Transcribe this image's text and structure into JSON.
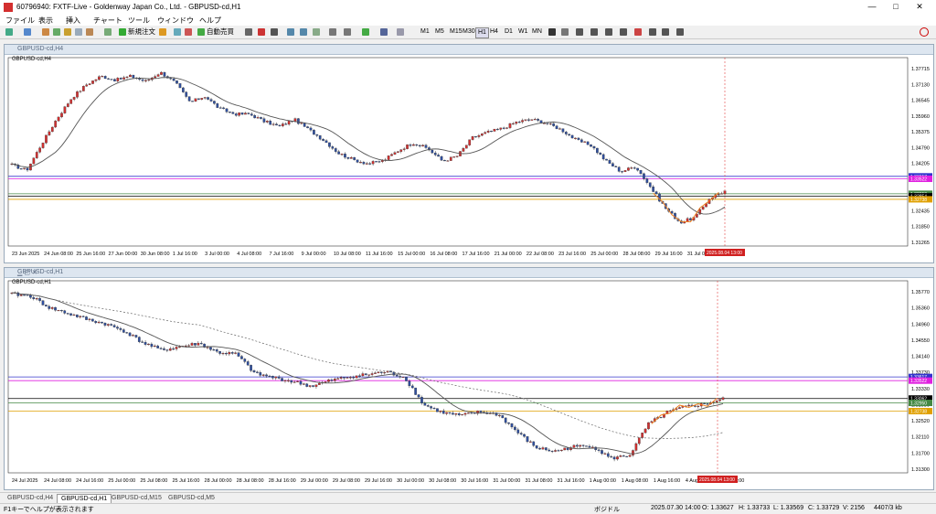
{
  "window": {
    "title": "60796940: FXTF-Live - Goldenway Japan Co., Ltd. - GBPUSD-cd,H1",
    "minimize": "—",
    "maximize": "□",
    "close": "✕"
  },
  "menu": [
    "ファイル",
    "表示",
    "挿入",
    "チャート",
    "ツール",
    "ウィンドウ",
    "ヘルプ"
  ],
  "toolbar": {
    "new_order": "新規注文",
    "auto_trade": "自動売買",
    "timeframes": [
      "M1",
      "M5",
      "M15",
      "M30",
      "H1",
      "H4",
      "D1",
      "W1",
      "MN"
    ]
  },
  "chart_h4": {
    "window_title": "GBPUSD-cd,H4",
    "symbol": "GBPUSD-cd,H4",
    "y_labels": [
      "1.37715",
      "1.37130",
      "1.36545",
      "1.35960",
      "1.35375",
      "1.34790",
      "1.34205",
      "1.33620",
      "1.33035",
      "1.32435",
      "1.31850",
      "1.31265"
    ],
    "price_tags": [
      {
        "text": "1.33617",
        "color": "#3333cc",
        "y": 1.33617
      },
      {
        "text": "1.33522",
        "color": "#e020e0",
        "y": 1.33522
      },
      {
        "text": "1.32950",
        "color": "#448844",
        "y": 1.3295
      },
      {
        "text": "1.32854",
        "color": "#000000",
        "y": 1.32854
      },
      {
        "text": "1.32738",
        "color": "#e0a000",
        "y": 1.32738
      }
    ],
    "x_labels": [
      "23 Jun 2025",
      "24 Jun 08:00",
      "25 Jun 16:00",
      "27 Jun 00:00",
      "30 Jun 08:00",
      "1 Jul 16:00",
      "3 Jul 00:00",
      "4 Jul 08:00",
      "7 Jul 16:00",
      "9 Jul 00:00",
      "10 Jul 08:00",
      "11 Jul 16:00",
      "15 Jul 00:00",
      "16 Jul 08:00",
      "17 Jul 16:00",
      "21 Jul 00:00",
      "22 Jul 08:00",
      "23 Jul 16:00",
      "25 Jul 00:00",
      "28 Jul 08:00",
      "29 Jul 16:00",
      "31 Jul 00:00",
      "1 Aug"
    ],
    "time_marker": "2025.08.04 13:00",
    "chart_data": {
      "type": "candlestick",
      "ylim": [
        1.3095,
        1.3795
      ],
      "close_path": [
        1.3405,
        1.3385,
        1.3485,
        1.358,
        1.366,
        1.3712,
        1.3745,
        1.373,
        1.3745,
        1.3725,
        1.376,
        1.372,
        1.3645,
        1.3668,
        1.362,
        1.36,
        1.36,
        1.3572,
        1.3552,
        1.358,
        1.354,
        1.35,
        1.345,
        1.3425,
        1.341,
        1.3422,
        1.346,
        1.349,
        1.3468,
        1.342,
        1.344,
        1.351,
        1.353,
        1.3545,
        1.357,
        1.358,
        1.3565,
        1.354,
        1.35,
        1.348,
        1.342,
        1.338,
        1.34,
        1.332,
        1.324,
        1.3185,
        1.3205,
        1.328,
        1.3305
      ]
    }
  },
  "chart_h1": {
    "window_title": "GBPUSD-cd,H1",
    "symbol": "GBPUSD-cd,H1",
    "y_labels": [
      "1.35770",
      "1.35360",
      "1.34960",
      "1.34550",
      "1.34140",
      "1.33730",
      "1.33330",
      "1.32930",
      "1.32520",
      "1.32110",
      "1.31700",
      "1.31300"
    ],
    "price_tags": [
      {
        "text": "1.33617",
        "color": "#3333cc",
        "y": 1.33617
      },
      {
        "text": "1.33522",
        "color": "#e020e0",
        "y": 1.33522
      },
      {
        "text": "1.33062",
        "color": "#000000",
        "y": 1.33062
      },
      {
        "text": "1.32950",
        "color": "#448844",
        "y": 1.3295
      },
      {
        "text": "1.32738",
        "color": "#e0a000",
        "y": 1.32738
      }
    ],
    "x_labels": [
      "24 Jul 2025",
      "24 Jul 08:00",
      "24 Jul 16:00",
      "25 Jul 00:00",
      "25 Jul 08:00",
      "25 Jul 16:00",
      "28 Jul 00:00",
      "28 Jul 08:00",
      "28 Jul 16:00",
      "29 Jul 00:00",
      "29 Jul 08:00",
      "29 Jul 16:00",
      "30 Jul 00:00",
      "30 Jul 08:00",
      "30 Jul 16:00",
      "31 Jul 00:00",
      "31 Jul 08:00",
      "31 Jul 16:00",
      "1 Aug 00:00",
      "1 Aug 08:00",
      "1 Aug 16:00",
      "4 Aug 00:00",
      "4 Aug 08:00"
    ],
    "time_marker": "2025.08.04 13:00",
    "chart_data": {
      "type": "candlestick",
      "ylim": [
        1.3115,
        1.3595
      ],
      "close_path": [
        1.3575,
        1.357,
        1.354,
        1.3525,
        1.351,
        1.3498,
        1.348,
        1.345,
        1.343,
        1.344,
        1.3448,
        1.3425,
        1.342,
        1.337,
        1.336,
        1.335,
        1.3338,
        1.3352,
        1.3362,
        1.3368,
        1.3375,
        1.336,
        1.329,
        1.327,
        1.3262,
        1.3272,
        1.3265,
        1.322,
        1.318,
        1.317,
        1.3182,
        1.3185,
        1.3152,
        1.316,
        1.324,
        1.327,
        1.3285,
        1.3292,
        1.3305
      ]
    }
  },
  "tabs": [
    "GBPUSD-cd,H4",
    "GBPUSD-cd,H1",
    "GBPUSD-cd,M15",
    "GBPUSD-cd,M5"
  ],
  "status": {
    "help": "F1キーでヘルプが表示されます",
    "profile": "ボジドル",
    "datetime": "2025.07.30 14:00",
    "open": "O: 1.33627",
    "high": "H: 1.33733",
    "low": "L: 1.33569",
    "close": "C: 1.33729",
    "volume": "V: 2156",
    "memory": "4407/3 kb"
  }
}
